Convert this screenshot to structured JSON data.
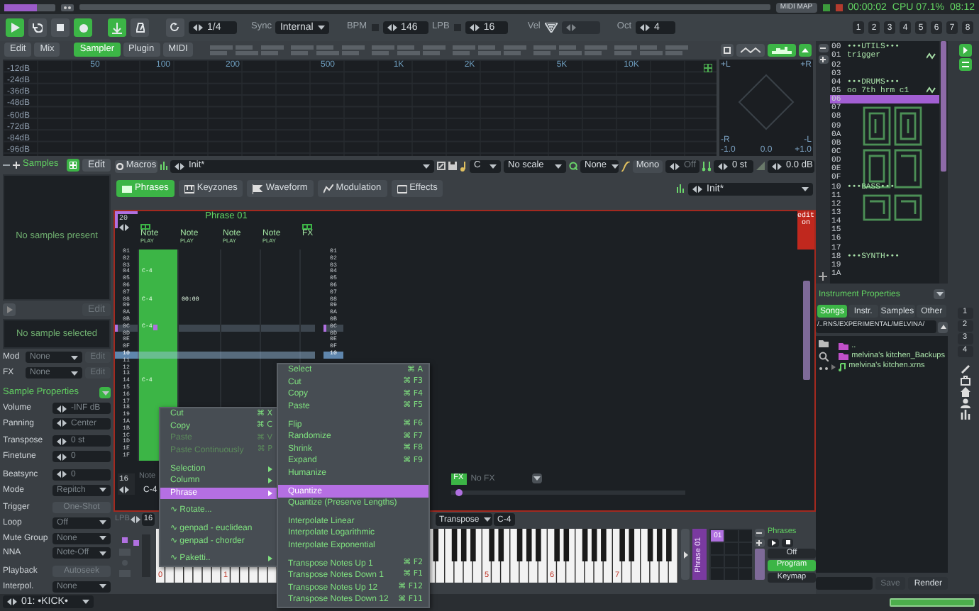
{
  "status": {
    "level": 0.65,
    "midi_map": "MIDI MAP",
    "time": "00:00:02",
    "cpu": "CPU 07.1%",
    "clock": "08:12"
  },
  "transport": {
    "playing": true,
    "edit_mode": true,
    "follow": true,
    "metronome": false,
    "block_loop": "1/4",
    "sync_label": "Sync",
    "sync": "Internal",
    "bpm_label": "BPM",
    "bpm": "146",
    "lpb_label": "LPB",
    "lpb": "16",
    "vel_label": "Vel",
    "oct_label": "Oct",
    "oct": "4",
    "tracks": [
      "1",
      "2",
      "3",
      "4",
      "5",
      "6",
      "7",
      "8"
    ]
  },
  "view_tabs": [
    {
      "label": "Edit",
      "selected": false
    },
    {
      "label": "Mix",
      "selected": false
    },
    {
      "label": "Sampler",
      "selected": true
    },
    {
      "label": "Plugin",
      "selected": false
    },
    {
      "label": "MIDI",
      "selected": false
    }
  ],
  "spectrum": {
    "db_labels": [
      "-12dB",
      "-24dB",
      "-36dB",
      "-48dB",
      "-60dB",
      "-72dB",
      "-84dB",
      "-96dB"
    ],
    "freq_labels": [
      "50",
      "100",
      "200",
      "500",
      "1K",
      "2K",
      "5K",
      "10K"
    ],
    "scope_labels": [
      "+L",
      "+R",
      "-R",
      "-L",
      "-1.0",
      "0.0",
      "+1.0"
    ]
  },
  "samples_panel": {
    "title": "Samples",
    "edit": "Edit",
    "empty": "No samples present",
    "edit_2": "Edit",
    "none_selected": "No sample selected",
    "mod": {
      "label": "Mod",
      "value": "None",
      "edit": "Edit"
    },
    "fx": {
      "label": "FX",
      "value": "None",
      "edit": "Edit"
    },
    "properties_title": "Sample Properties",
    "properties": [
      {
        "label": "Volume",
        "value": "-INF dB",
        "kind": "spin"
      },
      {
        "label": "Panning",
        "value": "Center",
        "kind": "spin"
      },
      {
        "label": "Transpose",
        "value": "0 st",
        "kind": "spin"
      },
      {
        "label": "Finetune",
        "value": "0",
        "kind": "spin"
      },
      {
        "label": "Beatsync",
        "value": "0",
        "kind": "spin"
      },
      {
        "label": "Mode",
        "value": "Repitch",
        "kind": "dropdown"
      },
      {
        "label": "Trigger",
        "value": "One-Shot",
        "kind": "button"
      },
      {
        "label": "Loop",
        "value": "Off",
        "kind": "dropdown"
      },
      {
        "label": "Mute Group",
        "value": "None",
        "kind": "dropdown"
      },
      {
        "label": "NNA",
        "value": "Note-Off",
        "kind": "dropdown"
      },
      {
        "label": "Playback",
        "value": "Autoseek",
        "kind": "button"
      },
      {
        "label": "Interpol.",
        "value": "None",
        "kind": "dropdown"
      }
    ]
  },
  "instrument_selector": "01: •KICK•",
  "instrument_bar": {
    "macros": "Macros",
    "preset": "Init*",
    "key": "C",
    "scale": "No scale",
    "quantize": "None",
    "mono": "Mono",
    "glide": "Off",
    "transpose": "0 st",
    "volume": "0.0 dB"
  },
  "editor_tabs": [
    {
      "label": "Phrases",
      "selected": true
    },
    {
      "label": "Keyzones",
      "selected": false
    },
    {
      "label": "Waveform",
      "selected": false
    },
    {
      "label": "Modulation",
      "selected": false
    },
    {
      "label": "Effects",
      "selected": false
    }
  ],
  "phrase_preset": "Init*",
  "phrase": {
    "lines": "20",
    "title": "Phrase 01",
    "edit_badge": "edit on",
    "columns": [
      {
        "name": "Note",
        "mode": "PLAY",
        "selected": true
      },
      {
        "name": "Note",
        "mode": "PLAY",
        "selected": false
      },
      {
        "name": "Note",
        "mode": "PLAY",
        "selected": false
      },
      {
        "name": "Note",
        "mode": "PLAY",
        "selected": false
      },
      {
        "name": "FX",
        "selected": false
      }
    ],
    "rows": [
      {
        "num": "01",
        "selected": false,
        "playing": false
      },
      {
        "num": "02",
        "selected": false,
        "playing": false
      },
      {
        "num": "03",
        "selected": false,
        "playing": false
      },
      {
        "num": "04",
        "note": "C-4",
        "selected": false,
        "playing": false
      },
      {
        "num": "05",
        "selected": false,
        "playing": false
      },
      {
        "num": "06",
        "selected": false,
        "playing": false
      },
      {
        "num": "07",
        "selected": false,
        "playing": false
      },
      {
        "num": "08",
        "note": "C-4",
        "col_2": "00:00",
        "selected": false,
        "playing": false
      },
      {
        "num": "09",
        "selected": false,
        "playing": false
      },
      {
        "num": "0A",
        "selected": false,
        "playing": false
      },
      {
        "num": "0B",
        "selected": false,
        "playing": false
      },
      {
        "num": "0C",
        "note": "C-4",
        "selected": true,
        "playing": false
      },
      {
        "num": "0D",
        "selected": false,
        "playing": false
      },
      {
        "num": "0E",
        "selected": false,
        "playing": false
      },
      {
        "num": "0F",
        "selected": false,
        "playing": false
      },
      {
        "num": "10",
        "selected": false,
        "playing": true
      },
      {
        "num": "11",
        "selected": false,
        "playing": false
      },
      {
        "num": "12",
        "selected": false,
        "playing": false
      },
      {
        "num": "13",
        "selected": false,
        "playing": false
      },
      {
        "num": "14",
        "note": "C-4",
        "selected": false,
        "playing": false
      },
      {
        "num": "15",
        "selected": false,
        "playing": false
      },
      {
        "num": "16",
        "selected": false,
        "playing": false
      },
      {
        "num": "17",
        "selected": false,
        "playing": false
      },
      {
        "num": "18",
        "selected": false,
        "playing": false
      },
      {
        "num": "19",
        "selected": false,
        "playing": false
      },
      {
        "num": "1A",
        "selected": false,
        "playing": false
      },
      {
        "num": "1B",
        "selected": false,
        "playing": false
      },
      {
        "num": "1C",
        "selected": false,
        "playing": false
      },
      {
        "num": "1D",
        "selected": false,
        "playing": false
      },
      {
        "num": "1E",
        "selected": false,
        "playing": false
      },
      {
        "num": "1F",
        "selected": false,
        "playing": false
      }
    ],
    "right_rows": [
      "01",
      "02",
      "03",
      "04",
      "05",
      "06",
      "07",
      "08",
      "09",
      "0A",
      "0B",
      "0C",
      "0D",
      "0E",
      "0F",
      "10"
    ],
    "footer": {
      "lpb": "16",
      "note_label": "Note",
      "note": "C-4",
      "fx_label": "FX",
      "fx": "No FX",
      "level": 0.02
    }
  },
  "keyboard_bar": {
    "lpb_label": "LPB",
    "lpb": "16",
    "transpose": "Transpose",
    "note": "C-4"
  },
  "keyboard": {
    "left_octave_labels": [
      "0",
      "1"
    ],
    "right_octave_labels": [
      "5",
      "6",
      "7"
    ]
  },
  "phrase_strip": "Phrase 01",
  "phrase_slot": "01",
  "phrases_label": "Phrases",
  "playback_modes": [
    {
      "label": "Off",
      "selected": false
    },
    {
      "label": "Program",
      "selected": true
    },
    {
      "label": "Keymap",
      "selected": false
    }
  ],
  "instruments": [
    {
      "number": "00",
      "name": "•••UTILS•••",
      "sample": false,
      "selected": false
    },
    {
      "number": "01",
      "name": "trigger",
      "sample": true,
      "selected": false
    },
    {
      "number": "02",
      "sample": false,
      "selected": false
    },
    {
      "number": "03",
      "sample": false,
      "selected": false
    },
    {
      "number": "04",
      "name": "•••DRUMS•••",
      "sample": false,
      "selected": false
    },
    {
      "number": "05",
      "name": "oo 7th hrm c1",
      "sample": true,
      "selected": false
    },
    {
      "number": "06",
      "sample": false,
      "selected": true
    },
    {
      "number": "07",
      "sample": false,
      "selected": false
    },
    {
      "number": "08",
      "sample": false,
      "selected": false
    },
    {
      "number": "09",
      "sample": false,
      "selected": false
    },
    {
      "number": "0A",
      "sample": false,
      "selected": false
    },
    {
      "number": "0B",
      "sample": false,
      "selected": false
    },
    {
      "number": "0C",
      "sample": false,
      "selected": false
    },
    {
      "number": "0D",
      "sample": false,
      "selected": false
    },
    {
      "number": "0E",
      "sample": false,
      "selected": false
    },
    {
      "number": "0F",
      "sample": false,
      "selected": false
    },
    {
      "number": "10",
      "name": "•••BASS•••",
      "sample": false,
      "selected": false
    },
    {
      "number": "11",
      "sample": false,
      "selected": false
    },
    {
      "number": "12",
      "sample": false,
      "selected": false
    },
    {
      "number": "13",
      "sample": false,
      "selected": false
    },
    {
      "number": "14",
      "sample": false,
      "selected": false
    },
    {
      "number": "15",
      "sample": false,
      "selected": false
    },
    {
      "number": "16",
      "sample": false,
      "selected": false
    },
    {
      "number": "17",
      "sample": false,
      "selected": false
    },
    {
      "number": "18",
      "name": "•••SYNTH•••",
      "sample": false,
      "selected": false
    },
    {
      "number": "19",
      "sample": false,
      "selected": false
    },
    {
      "number": "1A",
      "sample": false,
      "selected": false
    }
  ],
  "instrument_properties": "Instrument Properties",
  "browser_tabs": [
    {
      "label": "Songs",
      "selected": true
    },
    {
      "label": "Instr.",
      "selected": false
    },
    {
      "label": "Samples",
      "selected": false
    },
    {
      "label": "Other",
      "selected": false
    }
  ],
  "browser_path": "/..RNS/EXPERIMENTAL/MELVINA/",
  "files": [
    {
      "name": "..",
      "kind": "folder"
    },
    {
      "name": "melvina's kitchen_Backups",
      "kind": "folder"
    },
    {
      "name": "melvina's kitchen.xrns",
      "kind": "song"
    }
  ],
  "save": {
    "label": "Save",
    "disabled": true
  },
  "render": "Render",
  "side_buttons": [
    "1",
    "2",
    "3",
    "4"
  ],
  "context_menu": [
    {
      "kind": "item",
      "label": "Cut",
      "shortcut": "⌘ X",
      "disabled": false,
      "selected": false
    },
    {
      "kind": "item",
      "label": "Copy",
      "shortcut": "⌘ C",
      "disabled": false,
      "selected": false
    },
    {
      "kind": "item",
      "label": "Paste",
      "shortcut": "⌘ V",
      "disabled": true,
      "selected": false
    },
    {
      "kind": "item",
      "label": "Paste Continuously",
      "shortcut": "⌘ P",
      "disabled": true,
      "selected": false
    },
    {
      "kind": "separator"
    },
    {
      "kind": "submenu",
      "label": "Selection",
      "disabled": false,
      "selected": false
    },
    {
      "kind": "submenu",
      "label": "Column",
      "disabled": false,
      "selected": false
    },
    {
      "kind": "submenu",
      "label": "Phrase",
      "disabled": false,
      "selected": true
    },
    {
      "kind": "separator"
    },
    {
      "kind": "item",
      "label": "∿ Rotate...",
      "disabled": false,
      "selected": false
    },
    {
      "kind": "separator"
    },
    {
      "kind": "item",
      "label": "∿ genpad - euclidean",
      "disabled": false,
      "selected": false
    },
    {
      "kind": "item",
      "label": "∿ genpad - chorder",
      "disabled": false,
      "selected": false
    },
    {
      "kind": "separator"
    },
    {
      "kind": "submenu",
      "label": "∿ Paketti..",
      "disabled": false,
      "selected": false
    }
  ],
  "submenu": [
    {
      "kind": "item",
      "label": "Select",
      "shortcut": "⌘ A",
      "disabled": false,
      "selected": false
    },
    {
      "kind": "item",
      "label": "Cut",
      "shortcut": "⌘ F3",
      "disabled": false,
      "selected": false
    },
    {
      "kind": "item",
      "label": "Copy",
      "shortcut": "⌘ F4",
      "disabled": false,
      "selected": false
    },
    {
      "kind": "item",
      "label": "Paste",
      "shortcut": "⌘ F5",
      "disabled": false,
      "selected": false
    },
    {
      "kind": "separator"
    },
    {
      "kind": "item",
      "label": "Flip",
      "shortcut": "⌘ F6",
      "disabled": false,
      "selected": false
    },
    {
      "kind": "item",
      "label": "Randomize",
      "shortcut": "⌘ F7",
      "disabled": false,
      "selected": false
    },
    {
      "kind": "item",
      "label": "Shrink",
      "shortcut": "⌘ F8",
      "disabled": false,
      "selected": false
    },
    {
      "kind": "item",
      "label": "Expand",
      "shortcut": "⌘ F9",
      "disabled": false,
      "selected": false
    },
    {
      "kind": "item",
      "label": "Humanize",
      "disabled": false,
      "selected": false
    },
    {
      "kind": "separator"
    },
    {
      "kind": "item",
      "label": "Quantize",
      "disabled": false,
      "selected": true
    },
    {
      "kind": "item",
      "label": "Quantize (Preserve Lengths)",
      "disabled": false,
      "selected": false
    },
    {
      "kind": "separator"
    },
    {
      "kind": "item",
      "label": "Interpolate Linear",
      "disabled": false,
      "selected": false
    },
    {
      "kind": "item",
      "label": "Interpolate Logarithmic",
      "disabled": false,
      "selected": false
    },
    {
      "kind": "item",
      "label": "Interpolate Exponential",
      "disabled": false,
      "selected": false
    },
    {
      "kind": "separator"
    },
    {
      "kind": "item",
      "label": "Transpose Notes Up 1",
      "shortcut": "⌘ F2",
      "disabled": false,
      "selected": false
    },
    {
      "kind": "item",
      "label": "Transpose Notes Down 1",
      "shortcut": "⌘ F1",
      "disabled": false,
      "selected": false
    },
    {
      "kind": "item",
      "label": "Transpose Notes Up 12",
      "shortcut": "⌘ F12",
      "disabled": false,
      "selected": false
    },
    {
      "kind": "item",
      "label": "Transpose Notes Down 12",
      "shortcut": "⌘ F11",
      "disabled": false,
      "selected": false
    }
  ]
}
